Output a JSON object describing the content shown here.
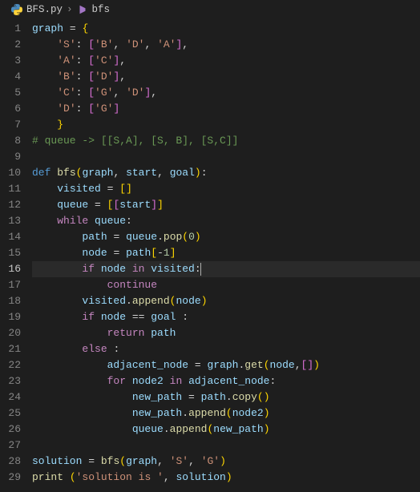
{
  "breadcrumb": {
    "file": "BFS.py",
    "symbol": "bfs"
  },
  "active_line": 16,
  "lines": [
    {
      "n": 1,
      "tokens": [
        {
          "t": "graph ",
          "c": "var"
        },
        {
          "t": "=",
          "c": "op"
        },
        {
          "t": " ",
          "c": "plain"
        },
        {
          "t": "{",
          "c": "brace"
        }
      ]
    },
    {
      "n": 2,
      "tokens": [
        {
          "t": "    ",
          "c": "plain"
        },
        {
          "t": "'S'",
          "c": "str"
        },
        {
          "t": ": ",
          "c": "plain"
        },
        {
          "t": "[",
          "c": "brace2"
        },
        {
          "t": "'B'",
          "c": "str"
        },
        {
          "t": ", ",
          "c": "plain"
        },
        {
          "t": "'D'",
          "c": "str"
        },
        {
          "t": ", ",
          "c": "plain"
        },
        {
          "t": "'A'",
          "c": "str"
        },
        {
          "t": "]",
          "c": "brace2"
        },
        {
          "t": ",",
          "c": "plain"
        }
      ]
    },
    {
      "n": 3,
      "tokens": [
        {
          "t": "    ",
          "c": "plain"
        },
        {
          "t": "'A'",
          "c": "str"
        },
        {
          "t": ": ",
          "c": "plain"
        },
        {
          "t": "[",
          "c": "brace2"
        },
        {
          "t": "'C'",
          "c": "str"
        },
        {
          "t": "]",
          "c": "brace2"
        },
        {
          "t": ",",
          "c": "plain"
        }
      ]
    },
    {
      "n": 4,
      "tokens": [
        {
          "t": "    ",
          "c": "plain"
        },
        {
          "t": "'B'",
          "c": "str"
        },
        {
          "t": ": ",
          "c": "plain"
        },
        {
          "t": "[",
          "c": "brace2"
        },
        {
          "t": "'D'",
          "c": "str"
        },
        {
          "t": "]",
          "c": "brace2"
        },
        {
          "t": ",",
          "c": "plain"
        }
      ]
    },
    {
      "n": 5,
      "tokens": [
        {
          "t": "    ",
          "c": "plain"
        },
        {
          "t": "'C'",
          "c": "str"
        },
        {
          "t": ": ",
          "c": "plain"
        },
        {
          "t": "[",
          "c": "brace2"
        },
        {
          "t": "'G'",
          "c": "str"
        },
        {
          "t": ", ",
          "c": "plain"
        },
        {
          "t": "'D'",
          "c": "str"
        },
        {
          "t": "]",
          "c": "brace2"
        },
        {
          "t": ",",
          "c": "plain"
        }
      ]
    },
    {
      "n": 6,
      "tokens": [
        {
          "t": "    ",
          "c": "plain"
        },
        {
          "t": "'D'",
          "c": "str"
        },
        {
          "t": ": ",
          "c": "plain"
        },
        {
          "t": "[",
          "c": "brace2"
        },
        {
          "t": "'G'",
          "c": "str"
        },
        {
          "t": "]",
          "c": "brace2"
        }
      ]
    },
    {
      "n": 7,
      "tokens": [
        {
          "t": "    ",
          "c": "plain"
        },
        {
          "t": "}",
          "c": "brace"
        }
      ]
    },
    {
      "n": 8,
      "tokens": [
        {
          "t": "# queue -> [[S,A], [S, B], [S,C]]",
          "c": "comment"
        }
      ]
    },
    {
      "n": 9,
      "tokens": []
    },
    {
      "n": 10,
      "tokens": [
        {
          "t": "def ",
          "c": "def"
        },
        {
          "t": "bfs",
          "c": "fn"
        },
        {
          "t": "(",
          "c": "brace"
        },
        {
          "t": "graph",
          "c": "var"
        },
        {
          "t": ", ",
          "c": "plain"
        },
        {
          "t": "start",
          "c": "var"
        },
        {
          "t": ", ",
          "c": "plain"
        },
        {
          "t": "goal",
          "c": "var"
        },
        {
          "t": ")",
          "c": "brace"
        },
        {
          "t": ":",
          "c": "plain"
        }
      ]
    },
    {
      "n": 11,
      "tokens": [
        {
          "t": "    ",
          "c": "plain"
        },
        {
          "t": "visited ",
          "c": "var"
        },
        {
          "t": "=",
          "c": "op"
        },
        {
          "t": " ",
          "c": "plain"
        },
        {
          "t": "[",
          "c": "brace"
        },
        {
          "t": "]",
          "c": "brace"
        }
      ]
    },
    {
      "n": 12,
      "tokens": [
        {
          "t": "    ",
          "c": "plain"
        },
        {
          "t": "queue ",
          "c": "var"
        },
        {
          "t": "=",
          "c": "op"
        },
        {
          "t": " ",
          "c": "plain"
        },
        {
          "t": "[",
          "c": "brace"
        },
        {
          "t": "[",
          "c": "brace2"
        },
        {
          "t": "start",
          "c": "var"
        },
        {
          "t": "]",
          "c": "brace2"
        },
        {
          "t": "]",
          "c": "brace"
        }
      ]
    },
    {
      "n": 13,
      "tokens": [
        {
          "t": "    ",
          "c": "plain"
        },
        {
          "t": "while ",
          "c": "kw"
        },
        {
          "t": "queue",
          "c": "var"
        },
        {
          "t": ":",
          "c": "plain"
        }
      ]
    },
    {
      "n": 14,
      "tokens": [
        {
          "t": "        ",
          "c": "plain"
        },
        {
          "t": "path ",
          "c": "var"
        },
        {
          "t": "=",
          "c": "op"
        },
        {
          "t": " ",
          "c": "plain"
        },
        {
          "t": "queue",
          "c": "var"
        },
        {
          "t": ".",
          "c": "plain"
        },
        {
          "t": "pop",
          "c": "fn"
        },
        {
          "t": "(",
          "c": "brace"
        },
        {
          "t": "0",
          "c": "num"
        },
        {
          "t": ")",
          "c": "brace"
        }
      ]
    },
    {
      "n": 15,
      "tokens": [
        {
          "t": "        ",
          "c": "plain"
        },
        {
          "t": "node ",
          "c": "var"
        },
        {
          "t": "=",
          "c": "op"
        },
        {
          "t": " ",
          "c": "plain"
        },
        {
          "t": "path",
          "c": "var"
        },
        {
          "t": "[",
          "c": "brace"
        },
        {
          "t": "-",
          "c": "op"
        },
        {
          "t": "1",
          "c": "num"
        },
        {
          "t": "]",
          "c": "brace"
        }
      ]
    },
    {
      "n": 16,
      "tokens": [
        {
          "t": "        ",
          "c": "plain"
        },
        {
          "t": "if ",
          "c": "kw"
        },
        {
          "t": "node ",
          "c": "var"
        },
        {
          "t": "in ",
          "c": "kw"
        },
        {
          "t": "visited",
          "c": "var"
        },
        {
          "t": ":",
          "c": "plain"
        }
      ],
      "cursor": true
    },
    {
      "n": 17,
      "tokens": [
        {
          "t": "            ",
          "c": "plain"
        },
        {
          "t": "continue",
          "c": "kw"
        }
      ]
    },
    {
      "n": 18,
      "tokens": [
        {
          "t": "        ",
          "c": "plain"
        },
        {
          "t": "visited",
          "c": "var"
        },
        {
          "t": ".",
          "c": "plain"
        },
        {
          "t": "append",
          "c": "fn"
        },
        {
          "t": "(",
          "c": "brace"
        },
        {
          "t": "node",
          "c": "var"
        },
        {
          "t": ")",
          "c": "brace"
        }
      ]
    },
    {
      "n": 19,
      "tokens": [
        {
          "t": "        ",
          "c": "plain"
        },
        {
          "t": "if ",
          "c": "kw"
        },
        {
          "t": "node ",
          "c": "var"
        },
        {
          "t": "==",
          "c": "op"
        },
        {
          "t": " ",
          "c": "plain"
        },
        {
          "t": "goal ",
          "c": "var"
        },
        {
          "t": ":",
          "c": "plain"
        }
      ]
    },
    {
      "n": 20,
      "tokens": [
        {
          "t": "            ",
          "c": "plain"
        },
        {
          "t": "return ",
          "c": "kw"
        },
        {
          "t": "path",
          "c": "var"
        }
      ]
    },
    {
      "n": 21,
      "tokens": [
        {
          "t": "        ",
          "c": "plain"
        },
        {
          "t": "else ",
          "c": "kw"
        },
        {
          "t": ":",
          "c": "plain"
        }
      ]
    },
    {
      "n": 22,
      "tokens": [
        {
          "t": "            ",
          "c": "plain"
        },
        {
          "t": "adjacent_node ",
          "c": "var"
        },
        {
          "t": "=",
          "c": "op"
        },
        {
          "t": " ",
          "c": "plain"
        },
        {
          "t": "graph",
          "c": "var"
        },
        {
          "t": ".",
          "c": "plain"
        },
        {
          "t": "get",
          "c": "fn"
        },
        {
          "t": "(",
          "c": "brace"
        },
        {
          "t": "node",
          "c": "var"
        },
        {
          "t": ",",
          "c": "plain"
        },
        {
          "t": "[",
          "c": "brace2"
        },
        {
          "t": "]",
          "c": "brace2"
        },
        {
          "t": ")",
          "c": "brace"
        }
      ]
    },
    {
      "n": 23,
      "tokens": [
        {
          "t": "            ",
          "c": "plain"
        },
        {
          "t": "for ",
          "c": "kw"
        },
        {
          "t": "node2 ",
          "c": "var"
        },
        {
          "t": "in ",
          "c": "kw"
        },
        {
          "t": "adjacent_node",
          "c": "var"
        },
        {
          "t": ":",
          "c": "plain"
        }
      ]
    },
    {
      "n": 24,
      "tokens": [
        {
          "t": "                ",
          "c": "plain"
        },
        {
          "t": "new_path ",
          "c": "var"
        },
        {
          "t": "=",
          "c": "op"
        },
        {
          "t": " ",
          "c": "plain"
        },
        {
          "t": "path",
          "c": "var"
        },
        {
          "t": ".",
          "c": "plain"
        },
        {
          "t": "copy",
          "c": "fn"
        },
        {
          "t": "(",
          "c": "brace"
        },
        {
          "t": ")",
          "c": "brace"
        }
      ]
    },
    {
      "n": 25,
      "tokens": [
        {
          "t": "                ",
          "c": "plain"
        },
        {
          "t": "new_path",
          "c": "var"
        },
        {
          "t": ".",
          "c": "plain"
        },
        {
          "t": "append",
          "c": "fn"
        },
        {
          "t": "(",
          "c": "brace"
        },
        {
          "t": "node2",
          "c": "var"
        },
        {
          "t": ")",
          "c": "brace"
        }
      ]
    },
    {
      "n": 26,
      "tokens": [
        {
          "t": "                ",
          "c": "plain"
        },
        {
          "t": "queue",
          "c": "var"
        },
        {
          "t": ".",
          "c": "plain"
        },
        {
          "t": "append",
          "c": "fn"
        },
        {
          "t": "(",
          "c": "brace"
        },
        {
          "t": "new_path",
          "c": "var"
        },
        {
          "t": ")",
          "c": "brace"
        }
      ]
    },
    {
      "n": 27,
      "tokens": []
    },
    {
      "n": 28,
      "tokens": [
        {
          "t": "solution ",
          "c": "var"
        },
        {
          "t": "=",
          "c": "op"
        },
        {
          "t": " ",
          "c": "plain"
        },
        {
          "t": "bfs",
          "c": "fn"
        },
        {
          "t": "(",
          "c": "brace"
        },
        {
          "t": "graph",
          "c": "var"
        },
        {
          "t": ", ",
          "c": "plain"
        },
        {
          "t": "'S'",
          "c": "str"
        },
        {
          "t": ", ",
          "c": "plain"
        },
        {
          "t": "'G'",
          "c": "str"
        },
        {
          "t": ")",
          "c": "brace"
        }
      ]
    },
    {
      "n": 29,
      "tokens": [
        {
          "t": "print ",
          "c": "fn"
        },
        {
          "t": "(",
          "c": "brace"
        },
        {
          "t": "'solution is '",
          "c": "str"
        },
        {
          "t": ", ",
          "c": "plain"
        },
        {
          "t": "solution",
          "c": "var"
        },
        {
          "t": ")",
          "c": "brace"
        }
      ]
    }
  ]
}
